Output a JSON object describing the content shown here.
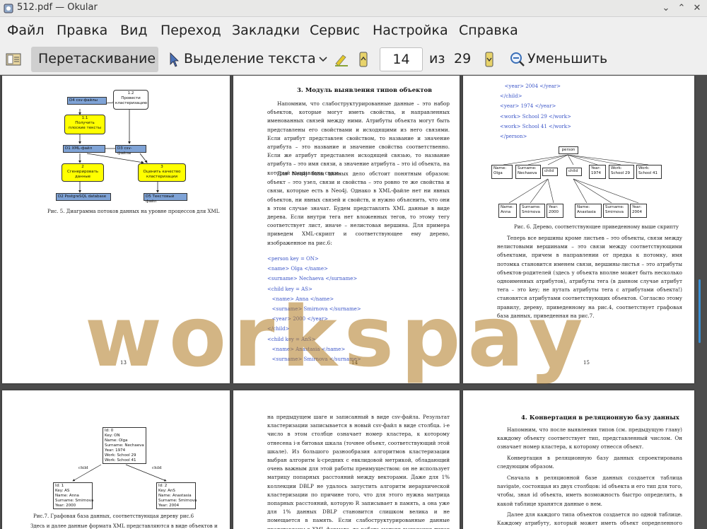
{
  "window": {
    "title": "512.pdf  — Okular",
    "buttons": {
      "minimize": "⌄",
      "maximize": "⌃",
      "close": "✕"
    }
  },
  "menu": [
    "Файл",
    "Правка",
    "Вид",
    "Переход",
    "Закладки",
    "Сервис",
    "Настройка",
    "Справка"
  ],
  "toolbar": {
    "drag_label": "Перетаскивание",
    "select_text_label": "Выделение текста",
    "current_page": "14",
    "of_label": "из",
    "total_pages": "29",
    "zoom_out_label": "Уменьшить"
  },
  "watermark": "workspay",
  "pages": {
    "p13": {
      "number": "13",
      "caption": "Рис. 5.  Диаграмма потоков данных на уровне процессов для XML",
      "boxes": {
        "d4": "D4   csv-файлы",
        "p12": "1.2\nПровести\nкластеризацию",
        "p11": "1.1\nПолучить\nплоские тексты",
        "d1": "D1   XML-файл",
        "d3": "D3   csv-файлы",
        "p2": "2\nСгенерировать\nданные",
        "p3": "3\nОценить качество\nкластеризации",
        "d2": "D2   PostgreSQL database",
        "d5": "D5   Текстовый файл"
      }
    },
    "p14": {
      "number": "14",
      "heading": "3. Модуль выявления типов объектов",
      "paragraph1": "Напомним, что слабоструктурированные данные – это набор объектов, которые могут иметь свойства, и направленных именованных связей между ними. Атрибуты объекта могут быть представлены его свойствами и исходящими из него связями. Если атрибут представлен свойством, то название и значение атрибута – это название и значение свойства соответственно. Если же атрибут представлен исходящей связью, то название атрибута – это имя связи, а значение атрибута – это id объекта, на который направлена связь.",
      "paragraph2": "Для Neo4j базы данных дело обстоит понятным образом: объект – это узел, связи и свойства – это ровно те же свойства и связи, которые есть в Neo4j. Однако в XML-файле нет ни явных объектов, ни явных связей и свойств, и нужно объяснить, что они в этом случае значат. Будем представлять XML данные в виде дерева. Если внутри тега нет вложенных тегов, то этому тегу соответствует лист, иначе – нелистовая вершина. Для примера приведем XML-скрипт и соответствующее ему дерево, изображенное на рис.6:",
      "code": [
        "<person key = ON>",
        "<name> Olga </name>",
        "<surname> Nechaeva </surname>",
        "<child key = AS>",
        "   <name> Anna </name>",
        "   <surname> Smirnova </surname>",
        "   <year> 2000 </year>",
        "</child>",
        "<child key = AnS>",
        "   <name> Anastasia </name>",
        "   <surname> Smirnova </surname>"
      ]
    },
    "p15": {
      "number": "15",
      "code": [
        "   <year> 2004 </year>",
        "</child>",
        "<year> 1974 </year>",
        "<work> School 29 </work>",
        "<work> School 41 </work>",
        "</person>"
      ],
      "tree": {
        "root": "person",
        "level1": [
          "Name:\nOlga",
          "Surname:\nNechaeva",
          "child",
          "child",
          "Year:\n1974",
          "Work:\nSchool 29",
          "Work:\nSchool 41"
        ],
        "level2": [
          "Name:\nAnna",
          "Surname:\nSmirnova",
          "Year:\n2000",
          "Name:\nAnastasia",
          "Surname:\nSmirnova",
          "Year:\n2004"
        ]
      },
      "caption": "Рис. 6.  Дерево, соответствующее приведенному выше скрипту",
      "paragraph": "Теперь все вершины кроме листьев – это объекты, связи между нелистовыми вершинами – это связи между соответствующими объектами, причем в направлении от предка к потомку, имя потомка становится именем связи, вершины-листья – это атрибуты объектов-родителей (здесь у объекта вполне может быть несколько одноименных атрибутов), атрибуты тега (в данном случае атрибут тега – это key; не путать атрибуты тега с атрибутами объекта!) становятся атрибутами соответствующих объектов. Согласно этому правилу, дереву, приведенному на рис.4, соответствует графовая база данных, приведенная на рис.7."
    },
    "p16": {
      "top_box": "Id: 0\nKey: ON\nName: Olga\nSurname: Nechaeva\nYear: 1974\nWork: School 29\nWork: School 41",
      "left_box": "Id: 1\nKey: AS\nName: Anna\nSurname: Smirnova\nYear: 2000",
      "right_box": "Id: 2\nKey: AnS\nName: Anastasia\nSurname: Smirnova\nYear: 2004",
      "edge_label": "child",
      "caption": "Рис.7.  Графовая база данных, соответствующая дереву рис.6",
      "footer_text": "Здесь и далее данные формата XML представляются в виде объектов и"
    },
    "p17": {
      "paragraph": "на предыдущем шаге и записанный в виде csv-файла. Результат кластеризации записывается в новый csv-файл в виде столбца. i-е число в этом столбце означает номер кластера, к которому отнесена i-я битовая шкала (точнее объект, соответствующий этой шкале). Из большого разнообразия алгоритмов кластеризации выбран алгоритм k-средних с евклидовой метрикой, обладающий очень важным для этой работы преимуществом: он не использует матрицу попарных расстояний между векторами. Даже для 1% коллекции DBLP не удалось запустить алгоритм иерархической кластеризации по причине того, что для этого нужна матрица попарных расстояний, которую R записывает в память, а она уже для 1% данных DBLP становится слишком велика и не помещается в память. Если слабоструктурированные данные представлены в XML-формате, то работа модуля выявления типов объектов на этом шаге"
    },
    "p18": {
      "heading": "4. Конвертация в реляционную базу данных",
      "paragraph1": "Напомним, что после выявления типов (см. предыдущую главу) каждому объекту соответствует тип, представленный числом. Он означает номер кластера, к которому отнесся объект.",
      "paragraph2": "Конвертация в реляционную базу данных спроектирована следующим образом.",
      "paragraph3": "Сначала в реляционной базе данных создается таблица navigate, состоящая из двух столбцов: id объекта и его тип для того, чтобы, зная id объекта, иметь возможность быстро определить, в какой таблице хранятся данные о нем.",
      "paragraph4": "Далее для каждого типа объектов создается по одной таблице. Каждому атрибуту, который может иметь объект определенного типа,"
    }
  }
}
